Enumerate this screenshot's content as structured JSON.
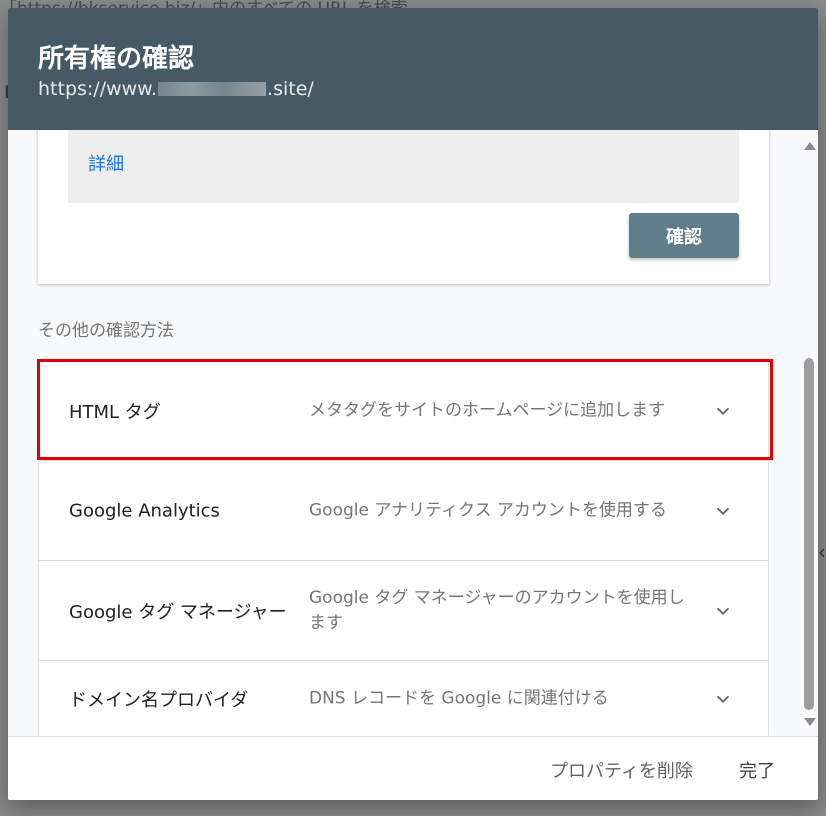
{
  "background": {
    "partial_text": "「https://bkservice.biz/」内のすべての URL を検索",
    "left_glyph": "リ",
    "right_glyph": "‹"
  },
  "dialog": {
    "title": "所有権の確認",
    "url_prefix": "https://www.",
    "url_suffix": ".site/"
  },
  "verification_card": {
    "details_link": "詳細",
    "verify_button": "確認"
  },
  "other_methods": {
    "heading": "その他の確認方法",
    "items": [
      {
        "name": "HTML タグ",
        "description": "メタタグをサイトのホームページに追加します",
        "highlighted": true
      },
      {
        "name": "Google Analytics",
        "description": "Google アナリティクス アカウントを使用する"
      },
      {
        "name": "Google タグ マネージャー",
        "description": "Google タグ マネージャーのアカウントを使用します"
      },
      {
        "name": "ドメイン名プロバイダ",
        "description": "DNS レコードを Google に関連付ける"
      }
    ]
  },
  "footer": {
    "delete_property": "プロパティを削除",
    "done": "完了"
  },
  "colors": {
    "header": "#455a64",
    "verify_button": "#607d8b",
    "link": "#1a73e8",
    "highlight": "#e00000"
  },
  "icons": {
    "chevron": "chevron-down-icon",
    "scroll_up": "scroll-up-arrow-icon",
    "scroll_down": "scroll-down-arrow-icon"
  }
}
